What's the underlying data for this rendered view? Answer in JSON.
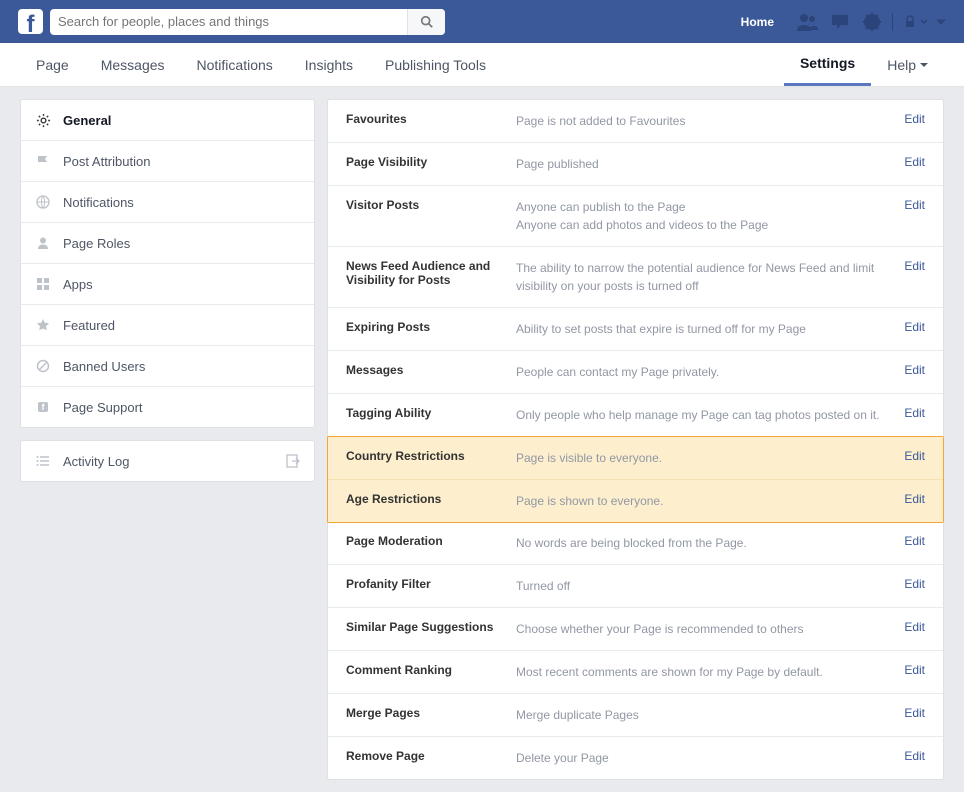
{
  "search": {
    "placeholder": "Search for people, places and things"
  },
  "top": {
    "home": "Home"
  },
  "nav": {
    "left": [
      "Page",
      "Messages",
      "Notifications",
      "Insights",
      "Publishing Tools"
    ],
    "settings": "Settings",
    "help": "Help"
  },
  "sidebar": {
    "items": [
      {
        "label": "General"
      },
      {
        "label": "Post Attribution"
      },
      {
        "label": "Notifications"
      },
      {
        "label": "Page Roles"
      },
      {
        "label": "Apps"
      },
      {
        "label": "Featured"
      },
      {
        "label": "Banned Users"
      },
      {
        "label": "Page Support"
      }
    ],
    "activity": "Activity Log"
  },
  "settings": [
    {
      "label": "Favourites",
      "desc": "Page is not added to Favourites",
      "edit": "Edit"
    },
    {
      "label": "Page Visibility",
      "desc": "Page published",
      "edit": "Edit"
    },
    {
      "label": "Visitor Posts",
      "desc": "Anyone can publish to the Page\nAnyone can add photos and videos to the Page",
      "edit": "Edit"
    },
    {
      "label": "News Feed Audience and Visibility for Posts",
      "desc": "The ability to narrow the potential audience for News Feed and limit visibility on your posts is turned off",
      "edit": "Edit"
    },
    {
      "label": "Expiring Posts",
      "desc": "Ability to set posts that expire is turned off for my Page",
      "edit": "Edit"
    },
    {
      "label": "Messages",
      "desc": "People can contact my Page privately.",
      "edit": "Edit"
    },
    {
      "label": "Tagging Ability",
      "desc": "Only people who help manage my Page can tag photos posted on it.",
      "edit": "Edit"
    },
    {
      "label": "Country Restrictions",
      "desc": "Page is visible to everyone.",
      "edit": "Edit"
    },
    {
      "label": "Age Restrictions",
      "desc": "Page is shown to everyone.",
      "edit": "Edit"
    },
    {
      "label": "Page Moderation",
      "desc": "No words are being blocked from the Page.",
      "edit": "Edit"
    },
    {
      "label": "Profanity Filter",
      "desc": "Turned off",
      "edit": "Edit"
    },
    {
      "label": "Similar Page Suggestions",
      "desc": "Choose whether your Page is recommended to others",
      "edit": "Edit"
    },
    {
      "label": "Comment Ranking",
      "desc": "Most recent comments are shown for my Page by default.",
      "edit": "Edit"
    },
    {
      "label": "Merge Pages",
      "desc": "Merge duplicate Pages",
      "edit": "Edit"
    },
    {
      "label": "Remove Page",
      "desc": "Delete your Page",
      "edit": "Edit"
    }
  ]
}
